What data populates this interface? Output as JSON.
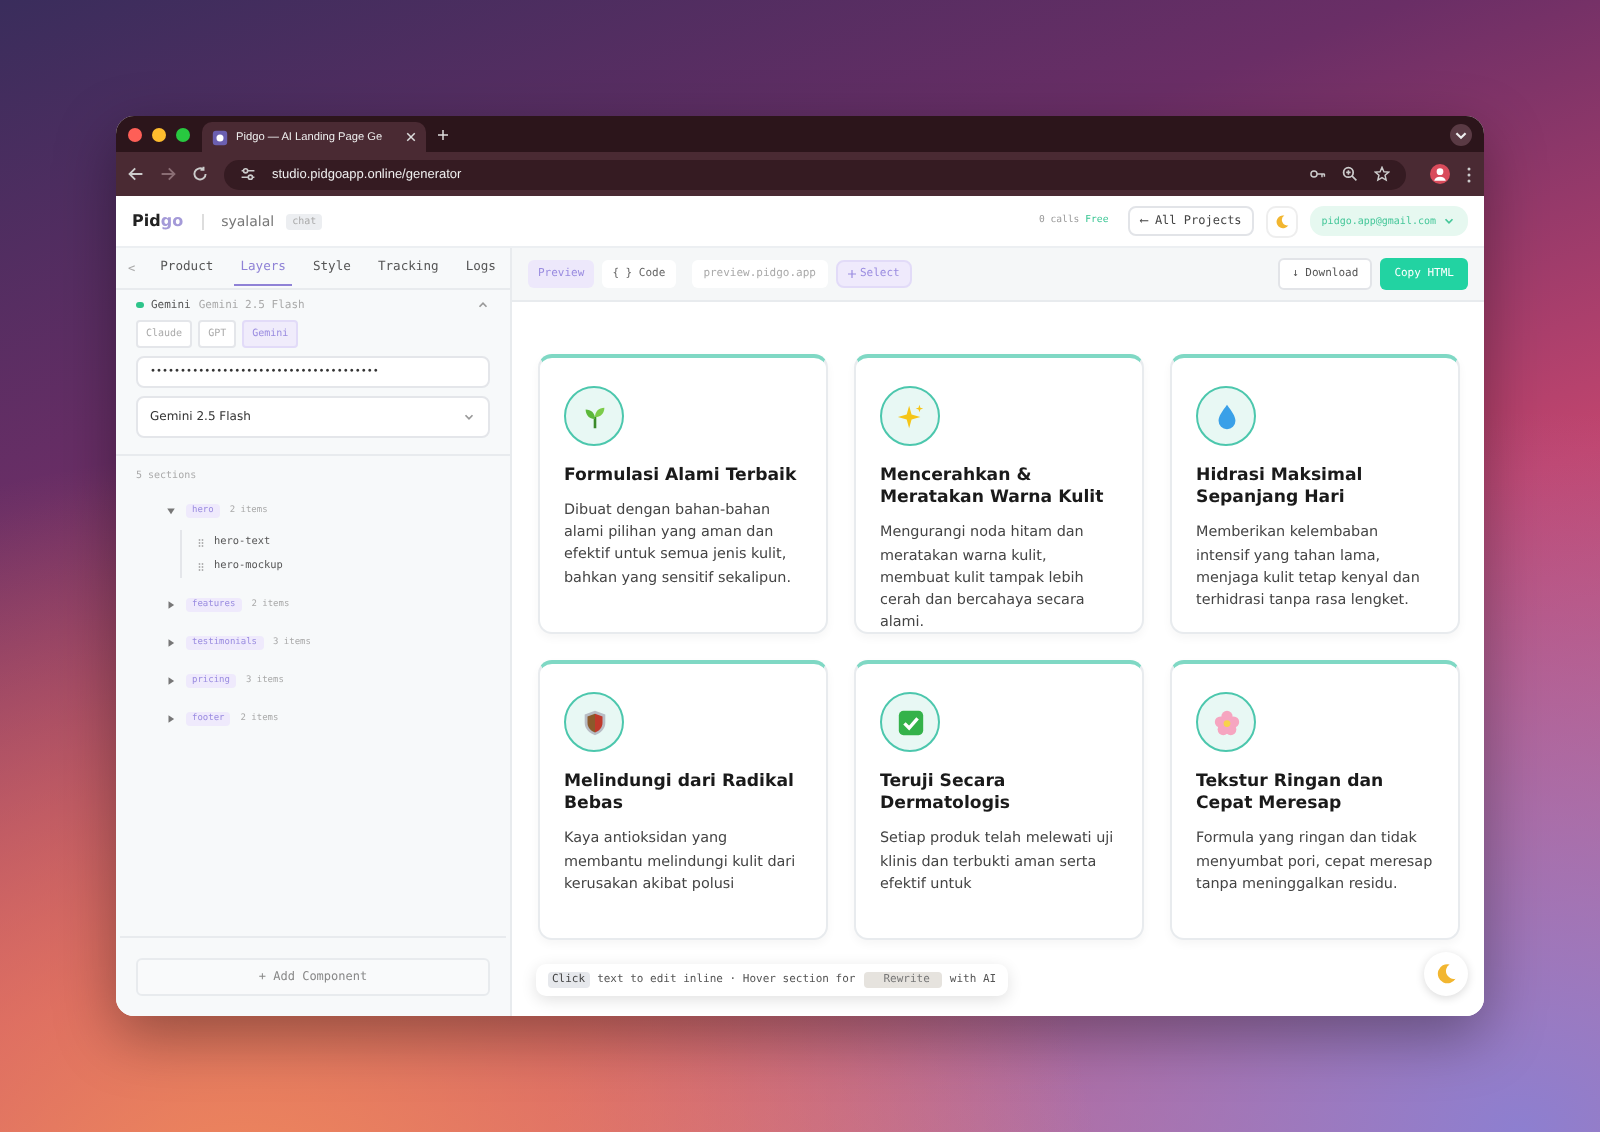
{
  "browser": {
    "tab_title": "Pidgo — AI Landing Page Ge",
    "url": "studio.pidgoapp.online/generator"
  },
  "header": {
    "brand_main": "Pid",
    "brand_accent": "go",
    "project": "syalalal",
    "project_badge": "chat",
    "calls": "0 calls",
    "plan": "Free",
    "all_projects": "⟵ All Projects",
    "account": "pidgo.app@gmail.com"
  },
  "sidebar": {
    "back": "<",
    "tabs": [
      {
        "label": "Product",
        "selected": false
      },
      {
        "label": "Layers",
        "selected": true
      },
      {
        "label": "Style",
        "selected": false
      },
      {
        "label": "Tracking",
        "selected": false
      },
      {
        "label": "Logs",
        "selected": false
      }
    ],
    "provider": {
      "connected": true,
      "name": "Gemini",
      "model": "Gemini 2.5 Flash",
      "expanded": true
    },
    "providers": [
      {
        "label": "Claude",
        "selected": false
      },
      {
        "label": "GPT",
        "selected": false
      },
      {
        "label": "Gemini",
        "selected": true
      }
    ],
    "api_key": "••••••••••••••••••••••••••••••••••••••",
    "model_select": "Gemini 2.5 Flash",
    "sections_count": "5 sections",
    "sections": [
      {
        "name": "hero",
        "count": "2 items",
        "expanded": true,
        "children": [
          {
            "name": "hero-text"
          },
          {
            "name": "hero-mockup"
          }
        ]
      },
      {
        "name": "features",
        "count": "2 items",
        "expanded": false
      },
      {
        "name": "testimonials",
        "count": "3 items",
        "expanded": false
      },
      {
        "name": "pricing",
        "count": "3 items",
        "expanded": false
      },
      {
        "name": "footer",
        "count": "2 items",
        "expanded": false
      }
    ],
    "add_component": "+ Add Component"
  },
  "toolbar": {
    "views": [
      {
        "label": "Preview",
        "selected": true
      },
      {
        "label": "{ } Code",
        "selected": false
      }
    ],
    "preview_url": "preview.pidgo.app",
    "select": "Select",
    "download": "↓ Download",
    "copy": "Copy HTML"
  },
  "cards": [
    {
      "kind": "sprout",
      "title": "Formulasi Alami Terbaik",
      "text": "Dibuat dengan bahan-bahan alami pilihan yang aman dan efektif untuk semua jenis kulit, bahkan yang sensitif sekalipun."
    },
    {
      "kind": "sparkle",
      "title": "Mencerahkan & Meratakan Warna Kulit",
      "text": "Mengurangi noda hitam dan meratakan warna kulit, membuat kulit tampak lebih cerah dan bercahaya secara alami."
    },
    {
      "kind": "droplet",
      "title": "Hidrasi Maksimal Sepanjang Hari",
      "text": "Memberikan kelembaban intensif yang tahan lama, menjaga kulit tetap kenyal dan terhidrasi tanpa rasa lengket."
    },
    {
      "kind": "shield",
      "title": "Melindungi dari Radikal Bebas",
      "text": "Kaya antioksidan yang membantu melindungi kulit dari kerusakan akibat polusi"
    },
    {
      "kind": "check",
      "title": "Teruji Secara Dermatologis",
      "text": "Setiap produk telah melewati uji klinis dan terbukti aman serta efektif untuk"
    },
    {
      "kind": "flower",
      "title": "Tekstur Ringan dan Cepat Meresap",
      "text": "Formula yang ringan dan tidak menyumbat pori, cepat meresap tanpa meninggalkan residu."
    }
  ],
  "hint": {
    "key": "Click",
    "middle": "text to edit inline · Hover section for",
    "chip": "Rewrite",
    "end": "with AI"
  }
}
